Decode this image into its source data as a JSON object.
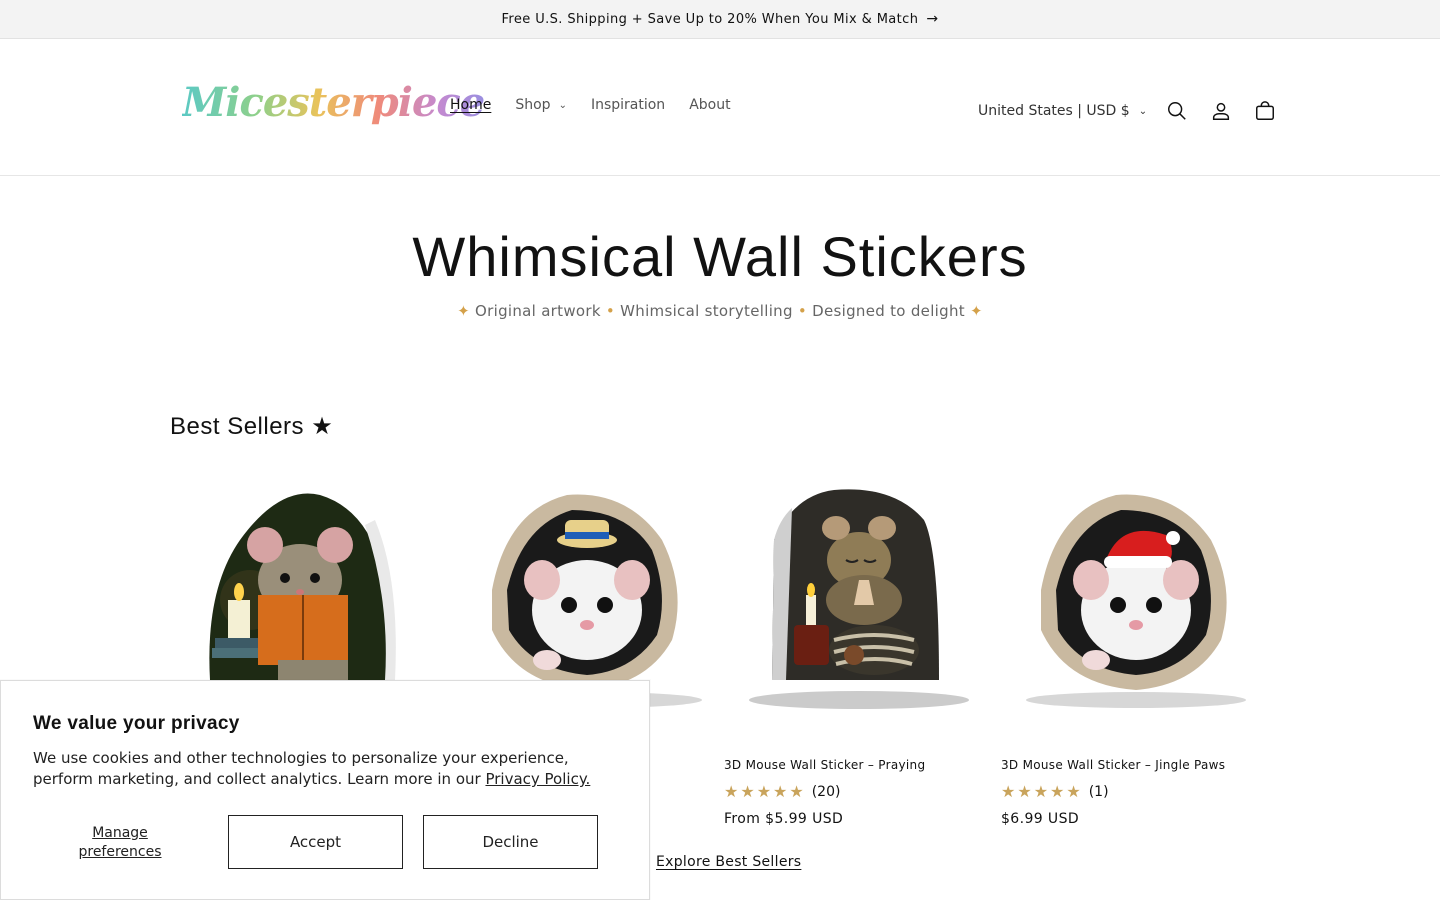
{
  "announcement": {
    "text": "Free U.S. Shipping + Save Up to 20% When You Mix & Match",
    "arrow": "→"
  },
  "header": {
    "logo_text": "Micesterpiece",
    "nav": [
      {
        "label": "Home",
        "active": true
      },
      {
        "label": "Shop",
        "has_dropdown": true
      },
      {
        "label": "Inspiration"
      },
      {
        "label": "About"
      }
    ],
    "locale": "United States | USD $",
    "icons": [
      "search-icon",
      "account-icon",
      "cart-icon"
    ]
  },
  "hero": {
    "title": "Whimsical Wall Stickers",
    "subtitle_parts": [
      "Original artwork",
      "Whimsical storytelling",
      "Designed to delight"
    ],
    "spark": "✦",
    "dot": "•"
  },
  "best_sellers": {
    "title": "Best Sellers ★",
    "products": [
      {
        "name": "",
        "stars": "★★★★★",
        "reviews": "",
        "price": ""
      },
      {
        "name": "",
        "stars": "★★★★★",
        "reviews": "",
        "price": ""
      },
      {
        "name": "3D Mouse Wall Sticker – Praying",
        "stars": "★★★★★",
        "reviews": "(20)",
        "price": "From $5.99 USD"
      },
      {
        "name": "3D Mouse Wall Sticker – Jingle Paws",
        "stars": "★★★★★",
        "reviews": "(1)",
        "price": "$6.99 USD"
      }
    ],
    "explore_label": "Explore Best Sellers"
  },
  "cookie_banner": {
    "title": "We value your privacy",
    "body": "We use cookies and other technologies to personalize your experience, perform marketing, and collect analytics. Learn more in our ",
    "link": "Privacy Policy.",
    "manage_label": "Manage preferences",
    "accept_label": "Accept",
    "decline_label": "Decline"
  },
  "colors": {
    "star": "#c9a45c",
    "spark": "#d4a14a",
    "announcement_bg": "#f3f3f3"
  }
}
